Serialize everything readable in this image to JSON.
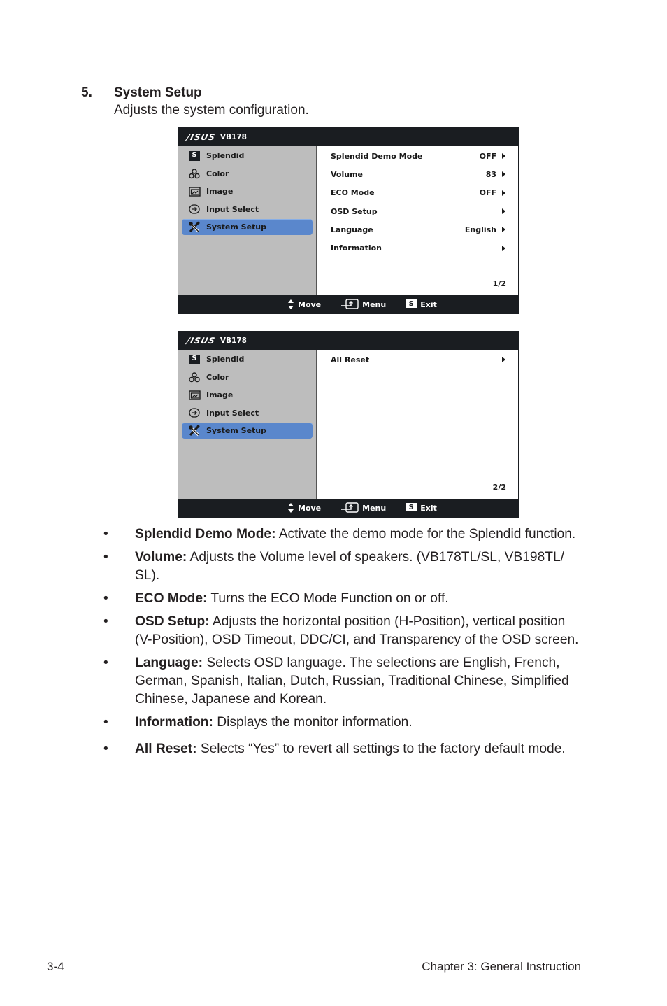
{
  "section": {
    "number": "5.",
    "title": "System Setup",
    "description": "Adjusts the system configuration."
  },
  "osd_common": {
    "brand": "/ISUS",
    "model": "VB178",
    "nav_items": [
      {
        "icon": "splendid-s-icon",
        "label": "Splendid"
      },
      {
        "icon": "color-icon",
        "label": "Color"
      },
      {
        "icon": "image-icon",
        "label": "Image"
      },
      {
        "icon": "input-select-icon",
        "label": "Input Select"
      },
      {
        "icon": "system-setup-icon",
        "label": "System Setup",
        "active": true
      }
    ],
    "footer": {
      "move": "Move",
      "menu": "Menu",
      "exit": "Exit",
      "exit_key": "S"
    }
  },
  "osd_page1": {
    "rows": [
      {
        "label": "Splendid Demo Mode",
        "value": "OFF"
      },
      {
        "label": "Volume",
        "value": "83"
      },
      {
        "label": "ECO Mode",
        "value": "OFF"
      },
      {
        "label": "OSD Setup",
        "value": ""
      },
      {
        "label": "Language",
        "value": "English"
      },
      {
        "label": "Information",
        "value": ""
      }
    ],
    "page": "1/2"
  },
  "osd_page2": {
    "rows": [
      {
        "label": "All Reset",
        "value": ""
      }
    ],
    "page": "2/2"
  },
  "bullets": [
    {
      "term": "Splendid Demo Mode:",
      "text": " Activate the demo mode for the Splendid function."
    },
    {
      "term": "Volume:",
      "text": " Adjusts the Volume level of speakers. (VB178TL/SL, VB198TL/ SL)."
    },
    {
      "term": "ECO Mode:",
      "text": " Turns the ECO Mode Function on or off."
    },
    {
      "term": "OSD Setup:",
      "text": " Adjusts the horizontal position (H-Position), vertical position (V-Position), OSD Timeout, DDC/CI, and Transparency of the OSD screen."
    },
    {
      "term": "Language:",
      "text": " Selects OSD language. The selections are English, French, German, Spanish, Italian, Dutch, Russian, Traditional Chinese, Simplified Chinese, Japanese and Korean."
    },
    {
      "term": "Information:",
      "text": " Displays the monitor information."
    },
    {
      "term": "All Reset:",
      "text": " Selects “Yes” to revert all settings to the factory default mode."
    }
  ],
  "bullet_glyph": "•",
  "footer": {
    "page_number": "3-4",
    "chapter": "Chapter 3: General Instruction"
  }
}
